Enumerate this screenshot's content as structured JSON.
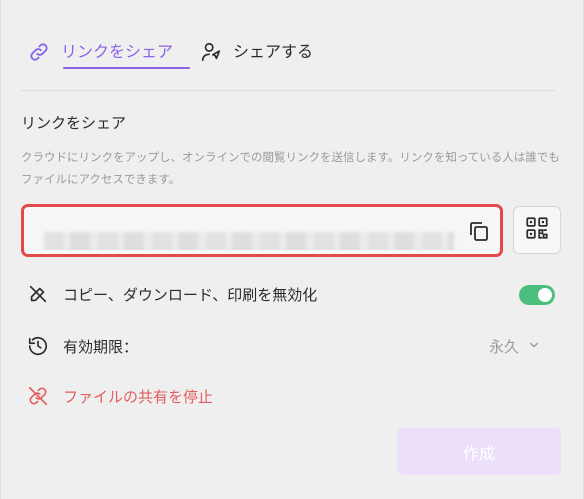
{
  "tabs": [
    {
      "label": "リンクをシェア",
      "active": true,
      "icon": "link-icon"
    },
    {
      "label": "シェアする",
      "active": false,
      "icon": "share-user-icon"
    }
  ],
  "share_link": {
    "title": "リンクをシェア",
    "description": "クラウドにリンクをアップし、オンラインでの閲覧リンクを送信します。リンクを知っている人は誰でもファイルにアクセスできます。",
    "url_value": "",
    "copy_icon": "copy-icon",
    "qr_icon": "qr-code-icon"
  },
  "options": {
    "disable_label": "コピー、ダウンロード、印刷を無効化",
    "disable_enabled": true,
    "expiry_label": "有効期限：",
    "expiry_value": "永久",
    "stop_label": "ファイルの共有を停止"
  },
  "actions": {
    "create_label": "作成"
  },
  "colors": {
    "accent": "#8a63e6",
    "toggle_on": "#4cbf7f",
    "danger": "#e35d5d",
    "highlight_border": "#e34a4a",
    "create_button_bg": "#ecdffc"
  }
}
